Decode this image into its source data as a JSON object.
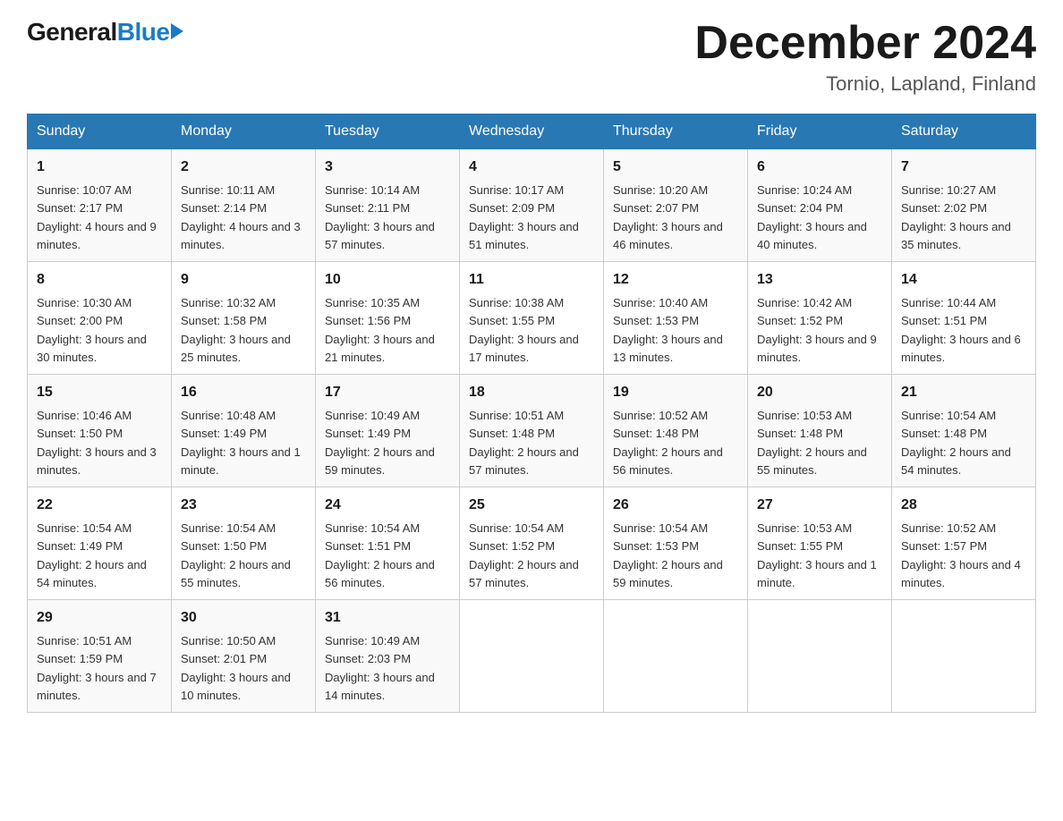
{
  "header": {
    "logo_general": "General",
    "logo_blue": "Blue",
    "month_title": "December 2024",
    "location": "Tornio, Lapland, Finland"
  },
  "days_of_week": [
    "Sunday",
    "Monday",
    "Tuesday",
    "Wednesday",
    "Thursday",
    "Friday",
    "Saturday"
  ],
  "weeks": [
    [
      {
        "day": "1",
        "sunrise": "10:07 AM",
        "sunset": "2:17 PM",
        "daylight": "4 hours and 9 minutes."
      },
      {
        "day": "2",
        "sunrise": "10:11 AM",
        "sunset": "2:14 PM",
        "daylight": "4 hours and 3 minutes."
      },
      {
        "day": "3",
        "sunrise": "10:14 AM",
        "sunset": "2:11 PM",
        "daylight": "3 hours and 57 minutes."
      },
      {
        "day": "4",
        "sunrise": "10:17 AM",
        "sunset": "2:09 PM",
        "daylight": "3 hours and 51 minutes."
      },
      {
        "day": "5",
        "sunrise": "10:20 AM",
        "sunset": "2:07 PM",
        "daylight": "3 hours and 46 minutes."
      },
      {
        "day": "6",
        "sunrise": "10:24 AM",
        "sunset": "2:04 PM",
        "daylight": "3 hours and 40 minutes."
      },
      {
        "day": "7",
        "sunrise": "10:27 AM",
        "sunset": "2:02 PM",
        "daylight": "3 hours and 35 minutes."
      }
    ],
    [
      {
        "day": "8",
        "sunrise": "10:30 AM",
        "sunset": "2:00 PM",
        "daylight": "3 hours and 30 minutes."
      },
      {
        "day": "9",
        "sunrise": "10:32 AM",
        "sunset": "1:58 PM",
        "daylight": "3 hours and 25 minutes."
      },
      {
        "day": "10",
        "sunrise": "10:35 AM",
        "sunset": "1:56 PM",
        "daylight": "3 hours and 21 minutes."
      },
      {
        "day": "11",
        "sunrise": "10:38 AM",
        "sunset": "1:55 PM",
        "daylight": "3 hours and 17 minutes."
      },
      {
        "day": "12",
        "sunrise": "10:40 AM",
        "sunset": "1:53 PM",
        "daylight": "3 hours and 13 minutes."
      },
      {
        "day": "13",
        "sunrise": "10:42 AM",
        "sunset": "1:52 PM",
        "daylight": "3 hours and 9 minutes."
      },
      {
        "day": "14",
        "sunrise": "10:44 AM",
        "sunset": "1:51 PM",
        "daylight": "3 hours and 6 minutes."
      }
    ],
    [
      {
        "day": "15",
        "sunrise": "10:46 AM",
        "sunset": "1:50 PM",
        "daylight": "3 hours and 3 minutes."
      },
      {
        "day": "16",
        "sunrise": "10:48 AM",
        "sunset": "1:49 PM",
        "daylight": "3 hours and 1 minute."
      },
      {
        "day": "17",
        "sunrise": "10:49 AM",
        "sunset": "1:49 PM",
        "daylight": "2 hours and 59 minutes."
      },
      {
        "day": "18",
        "sunrise": "10:51 AM",
        "sunset": "1:48 PM",
        "daylight": "2 hours and 57 minutes."
      },
      {
        "day": "19",
        "sunrise": "10:52 AM",
        "sunset": "1:48 PM",
        "daylight": "2 hours and 56 minutes."
      },
      {
        "day": "20",
        "sunrise": "10:53 AM",
        "sunset": "1:48 PM",
        "daylight": "2 hours and 55 minutes."
      },
      {
        "day": "21",
        "sunrise": "10:54 AM",
        "sunset": "1:48 PM",
        "daylight": "2 hours and 54 minutes."
      }
    ],
    [
      {
        "day": "22",
        "sunrise": "10:54 AM",
        "sunset": "1:49 PM",
        "daylight": "2 hours and 54 minutes."
      },
      {
        "day": "23",
        "sunrise": "10:54 AM",
        "sunset": "1:50 PM",
        "daylight": "2 hours and 55 minutes."
      },
      {
        "day": "24",
        "sunrise": "10:54 AM",
        "sunset": "1:51 PM",
        "daylight": "2 hours and 56 minutes."
      },
      {
        "day": "25",
        "sunrise": "10:54 AM",
        "sunset": "1:52 PM",
        "daylight": "2 hours and 57 minutes."
      },
      {
        "day": "26",
        "sunrise": "10:54 AM",
        "sunset": "1:53 PM",
        "daylight": "2 hours and 59 minutes."
      },
      {
        "day": "27",
        "sunrise": "10:53 AM",
        "sunset": "1:55 PM",
        "daylight": "3 hours and 1 minute."
      },
      {
        "day": "28",
        "sunrise": "10:52 AM",
        "sunset": "1:57 PM",
        "daylight": "3 hours and 4 minutes."
      }
    ],
    [
      {
        "day": "29",
        "sunrise": "10:51 AM",
        "sunset": "1:59 PM",
        "daylight": "3 hours and 7 minutes."
      },
      {
        "day": "30",
        "sunrise": "10:50 AM",
        "sunset": "2:01 PM",
        "daylight": "3 hours and 10 minutes."
      },
      {
        "day": "31",
        "sunrise": "10:49 AM",
        "sunset": "2:03 PM",
        "daylight": "3 hours and 14 minutes."
      },
      null,
      null,
      null,
      null
    ]
  ]
}
